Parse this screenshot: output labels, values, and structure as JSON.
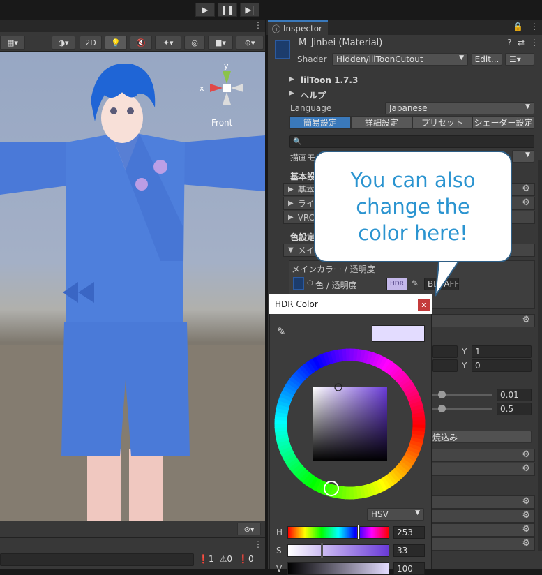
{
  "playback": {
    "play_icon": "play-icon",
    "pause_icon": "pause-icon",
    "step_icon": "step-icon"
  },
  "scene": {
    "toolbar": {
      "mode_2d": "2D"
    },
    "gizmo": {
      "axis_x": "x",
      "axis_y": "y",
      "view_label": "Front"
    }
  },
  "console": {
    "errors": "1",
    "warnings": "0",
    "messages": "0"
  },
  "inspector": {
    "tab_label": "Inspector",
    "material_name": "M_Jinbei (Material)",
    "shader_label": "Shader",
    "shader_value": "Hidden/lilToonCutout",
    "edit_button": "Edit...",
    "version_label": "lilToon 1.7.3",
    "help_label": "ヘルプ",
    "language_label": "Language",
    "language_value": "Japanese",
    "tabs": [
      "簡易設定",
      "詳細設定",
      "プリセット",
      "シェーダー設定"
    ],
    "render_mode_label": "描画モ",
    "basic_settings_header": "基本設",
    "basic_rows": [
      "基本",
      "ライテ",
      "VRC"
    ],
    "color_settings_header": "色設定",
    "main_row": "メイン",
    "main_color_group": "メインカラー / 透明度",
    "color_alpha_label": "色 / 透明度",
    "hdr_badge": "HDR",
    "color_hex": "BDFAFF",
    "uv_y1": "Y",
    "uv_y1_value": "1",
    "uv_y2": "Y",
    "uv_y2_value": "0",
    "slider1_value": "0.01",
    "slider2_value": "0.5",
    "bake_button": "焼込み"
  },
  "callout": {
    "lines": [
      "You can also",
      "change the",
      "color here!"
    ]
  },
  "color_picker": {
    "title": "HDR Color",
    "close_label": "x",
    "mode": "HSV",
    "preview_color": "#e3dcff",
    "h_label": "H",
    "h_value": "253",
    "s_label": "S",
    "s_value": "33",
    "v_label": "V",
    "v_value": "100"
  }
}
